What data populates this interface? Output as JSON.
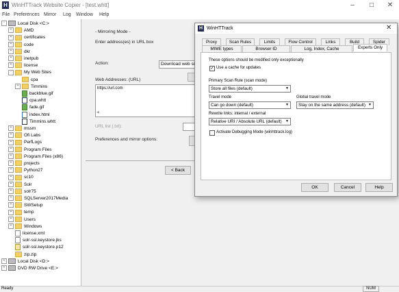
{
  "window": {
    "title": "WinHTTrack Website Copier - [test.whtt]",
    "icon": "H"
  },
  "menu": [
    "File",
    "Preferences",
    "Mirror",
    "Log",
    "Window",
    "Help"
  ],
  "tree": [
    {
      "label": "Local Disk <C:>",
      "type": "drive",
      "indent": 0,
      "exp": "-"
    },
    {
      "label": "AMD",
      "type": "folder",
      "indent": 1,
      "exp": "+"
    },
    {
      "label": "certificates",
      "type": "folder",
      "indent": 1,
      "exp": "+"
    },
    {
      "label": "code",
      "type": "folder",
      "indent": 1,
      "exp": "+"
    },
    {
      "label": "dkr",
      "type": "folder",
      "indent": 1,
      "exp": "+"
    },
    {
      "label": "inetpub",
      "type": "folder",
      "indent": 1,
      "exp": "+"
    },
    {
      "label": "license",
      "type": "folder",
      "indent": 1,
      "exp": "+"
    },
    {
      "label": "My Web Sites",
      "type": "folder",
      "indent": 1,
      "exp": "-"
    },
    {
      "label": "cpa",
      "type": "folder",
      "indent": 2,
      "exp": ""
    },
    {
      "label": "Timmins",
      "type": "folder",
      "indent": 2,
      "exp": "+"
    },
    {
      "label": "backblue.gif",
      "type": "gif",
      "indent": 2,
      "exp": ""
    },
    {
      "label": "cpa.whtt",
      "type": "whtt",
      "indent": 2,
      "exp": ""
    },
    {
      "label": "fade.gif",
      "type": "gif",
      "indent": 2,
      "exp": ""
    },
    {
      "label": "index.html",
      "type": "html",
      "indent": 2,
      "exp": ""
    },
    {
      "label": "Timmins.whtt",
      "type": "whtt",
      "indent": 2,
      "exp": ""
    },
    {
      "label": "mssm",
      "type": "folder",
      "indent": 1,
      "exp": "+"
    },
    {
      "label": "Ofi Labs",
      "type": "folder",
      "indent": 1,
      "exp": "+"
    },
    {
      "label": "PerfLogs",
      "type": "folder",
      "indent": 1,
      "exp": "+"
    },
    {
      "label": "Program Files",
      "type": "folder",
      "indent": 1,
      "exp": "+"
    },
    {
      "label": "Program Files (x86)",
      "type": "folder",
      "indent": 1,
      "exp": "+"
    },
    {
      "label": "projects",
      "type": "folder",
      "indent": 1,
      "exp": "+"
    },
    {
      "label": "Python27",
      "type": "folder",
      "indent": 1,
      "exp": "+"
    },
    {
      "label": "sc10",
      "type": "folder",
      "indent": 1,
      "exp": "+"
    },
    {
      "label": "Solr",
      "type": "folder",
      "indent": 1,
      "exp": "+"
    },
    {
      "label": "solr75",
      "type": "folder",
      "indent": 1,
      "exp": "+"
    },
    {
      "label": "SQLServer2017Media",
      "type": "folder",
      "indent": 1,
      "exp": "+"
    },
    {
      "label": "SWSetup",
      "type": "folder",
      "indent": 1,
      "exp": "+"
    },
    {
      "label": "temp",
      "type": "folder",
      "indent": 1,
      "exp": "+"
    },
    {
      "label": "Users",
      "type": "folder",
      "indent": 1,
      "exp": "+"
    },
    {
      "label": "Windows",
      "type": "folder",
      "indent": 1,
      "exp": "+"
    },
    {
      "label": "license.xml",
      "type": "file",
      "indent": 1,
      "exp": ""
    },
    {
      "label": "solr-ssl.keystore.jks",
      "type": "file",
      "indent": 1,
      "exp": ""
    },
    {
      "label": "solr-ssl.keystore.p12",
      "type": "key",
      "indent": 1,
      "exp": ""
    },
    {
      "label": "zip.zip",
      "type": "folder",
      "indent": 1,
      "exp": ""
    },
    {
      "label": "Local Disk <D:>",
      "type": "drive",
      "indent": 0,
      "exp": "+"
    },
    {
      "label": "DVD RW Drive <E:>",
      "type": "drive",
      "indent": 0,
      "exp": "+"
    }
  ],
  "wizard": {
    "section_title": "- Mirroring Mode -",
    "enter_address": "Enter address(es) in URL box",
    "action_label": "Action:",
    "action_value": "Download web sit",
    "web_addresses_label": "Web Addresses: (URL)",
    "url_value": "https://url.com",
    "url_list_label": "URL list (.txt):",
    "prefs_label": "Preferences and mirror options:",
    "back_button": "< Back"
  },
  "dialog": {
    "title": "WinHTTrack",
    "tabs_row1": [
      "Proxy",
      "Scan Rules",
      "Limits",
      "Flow Control",
      "Links",
      "Build",
      "Spider"
    ],
    "tabs_row2": [
      "MIME types",
      "Browser ID",
      "Log, Index, Cache",
      "Experts Only"
    ],
    "active_tab": "Experts Only",
    "warning": "These options should be modified only exceptionally",
    "use_cache_label": "Use a cache for updates",
    "use_cache_checked": true,
    "primary_scan_label": "Primary Scan Rule (scan mode)",
    "primary_scan_value": "Store all files (default)",
    "travel_mode_label": "Travel mode",
    "travel_mode_value": "Can go down (default)",
    "global_travel_label": "Global travel mode",
    "global_travel_value": "Stay on the same address  (default)",
    "rewrite_label": "Rewrite links: internal / external",
    "rewrite_value": "Relative URI / Absolute URL (default)",
    "debug_label": "Activate Debugging Mode (winhttrack.log)",
    "debug_checked": false,
    "ok": "OK",
    "cancel": "Cancel",
    "help": "Help"
  },
  "status": {
    "text": "Ready",
    "num": "NUM"
  }
}
